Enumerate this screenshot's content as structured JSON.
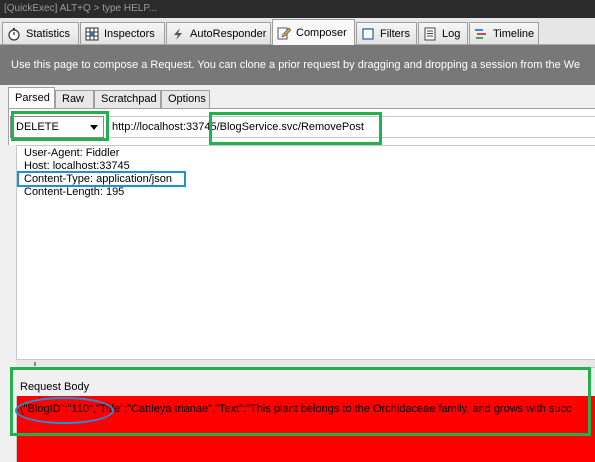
{
  "quickexec": {
    "text": "[QuickExec] ALT+Q > type HELP..."
  },
  "main_tabs": [
    {
      "label": "Statistics",
      "icon": "stopwatch-icon"
    },
    {
      "label": "Inspectors",
      "icon": "inspector-grid-icon"
    },
    {
      "label": "AutoResponder",
      "icon": "lightning-icon"
    },
    {
      "label": "Composer",
      "icon": "pencil-icon",
      "active": true
    },
    {
      "label": "Filters",
      "icon": "filter-checkbox-icon"
    },
    {
      "label": "Log",
      "icon": "log-page-icon"
    },
    {
      "label": "Timeline",
      "icon": "timeline-bars-icon"
    }
  ],
  "banner": {
    "text": "Use this page to compose a Request. You can clone a prior request by dragging and dropping a session from the We"
  },
  "sub_tabs": [
    {
      "label": "Parsed",
      "active": true
    },
    {
      "label": "Raw"
    },
    {
      "label": "Scratchpad"
    },
    {
      "label": "Options"
    }
  ],
  "request": {
    "method": "DELETE",
    "url": "http://localhost:33745/BlogService.svc/RemovePost"
  },
  "headers": [
    "User-Agent: Fiddler",
    "Host: localhost:33745",
    "Content-Type: application/json",
    "Content-Length: 195"
  ],
  "request_body": {
    "label": "Request Body",
    "text": "{\"BlogID\":\"110\",\"Title\":\"Cattleya trianae\",\"Text\":\"This plant belongs to the Orchidaceae family, and grows  with succ"
  },
  "colors": {
    "body_highlight": "#ff0000",
    "annotation_green": "#22b14c",
    "annotation_blue": "#1e90d6",
    "banner_background": "#787878"
  }
}
